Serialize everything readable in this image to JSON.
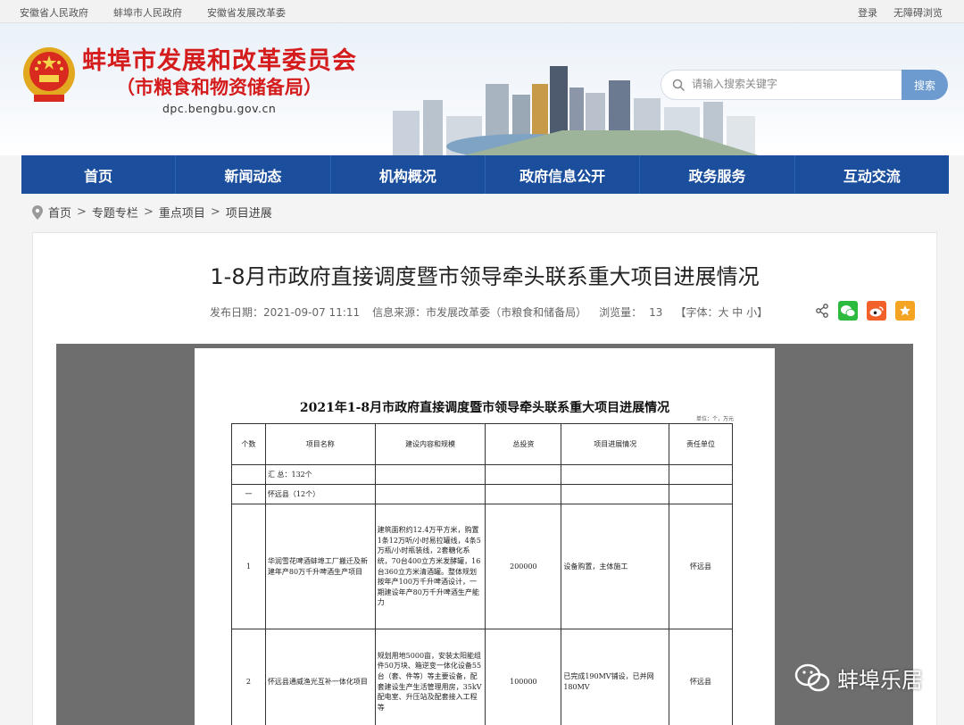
{
  "topbar": {
    "links_left": [
      "安徽省人民政府",
      "蚌埠市人民政府",
      "安徽省发展改革委"
    ],
    "links_right": [
      "登录",
      "无障碍浏览"
    ]
  },
  "header": {
    "title": "蚌埠市发展和改革委员会",
    "subtitle": "（市粮食和物资储备局）",
    "domain": "dpc.bengbu.gov.cn",
    "search_placeholder": "请输入搜索关键字",
    "search_button": "搜索"
  },
  "nav": [
    "首页",
    "新闻动态",
    "机构概况",
    "政府信息公开",
    "政务服务",
    "互动交流"
  ],
  "breadcrumb": [
    "首页",
    "专题专栏",
    "重点项目",
    "项目进展"
  ],
  "article": {
    "title": "1-8月市政府直接调度暨市领导牵头联系重大项目进展情况",
    "date_label": "发布日期：2021-09-07 11:11",
    "source_label": "信息来源：市发展改革委（市粮食和储备局）",
    "views_label": "浏览量：",
    "views": "13",
    "font_label": "【字体：大 中 小】"
  },
  "document": {
    "title": "2021年1-8月市政府直接调度暨市领导牵头联系重大项目进展情况",
    "unit": "单位：个，万元",
    "headers": [
      "个数",
      "项目名称",
      "建设内容和规模",
      "总投资",
      "项目进展情况",
      "责任单位"
    ],
    "total_row": "汇 总：132个",
    "group_index": "一",
    "group_row": "怀远县（12个）",
    "rows": [
      {
        "idx": "1",
        "name": "华润雪花啤酒蚌埠工厂搬迁及新建年产80万千升啤酒生产项目",
        "scope": "建筑面积约12.4万平方米，购置1条12万听/小时易拉罐线，4条5万瓶/小时瓶装线，2套糖化系统，70台400立方米发酵罐，16台360立方米清酒罐。整体规划按年产100万千升啤酒设计，一期建设年产80万千升啤酒生产能力",
        "investment": "200000",
        "progress": "设备购置，主体施工",
        "unit": "怀远县"
      },
      {
        "idx": "2",
        "name": "怀远县通威渔光互补一体化项目",
        "scope": "规划用地5000亩，安装太阳能组件50万块、箱逆变一体化设备55台（套、件等）等主要设备，配套建设生产生活管理用房，35kV配电室、升压站及配套接入工程等",
        "investment": "100000",
        "progress": "已完成190MV铺设，已并网180MV",
        "unit": "怀远县"
      }
    ]
  },
  "watermark": "蚌埠乐居",
  "colors": {
    "nav_bg": "#1b4f9d",
    "title_red": "#d41c1c",
    "search_btn": "#6d9bd0"
  }
}
